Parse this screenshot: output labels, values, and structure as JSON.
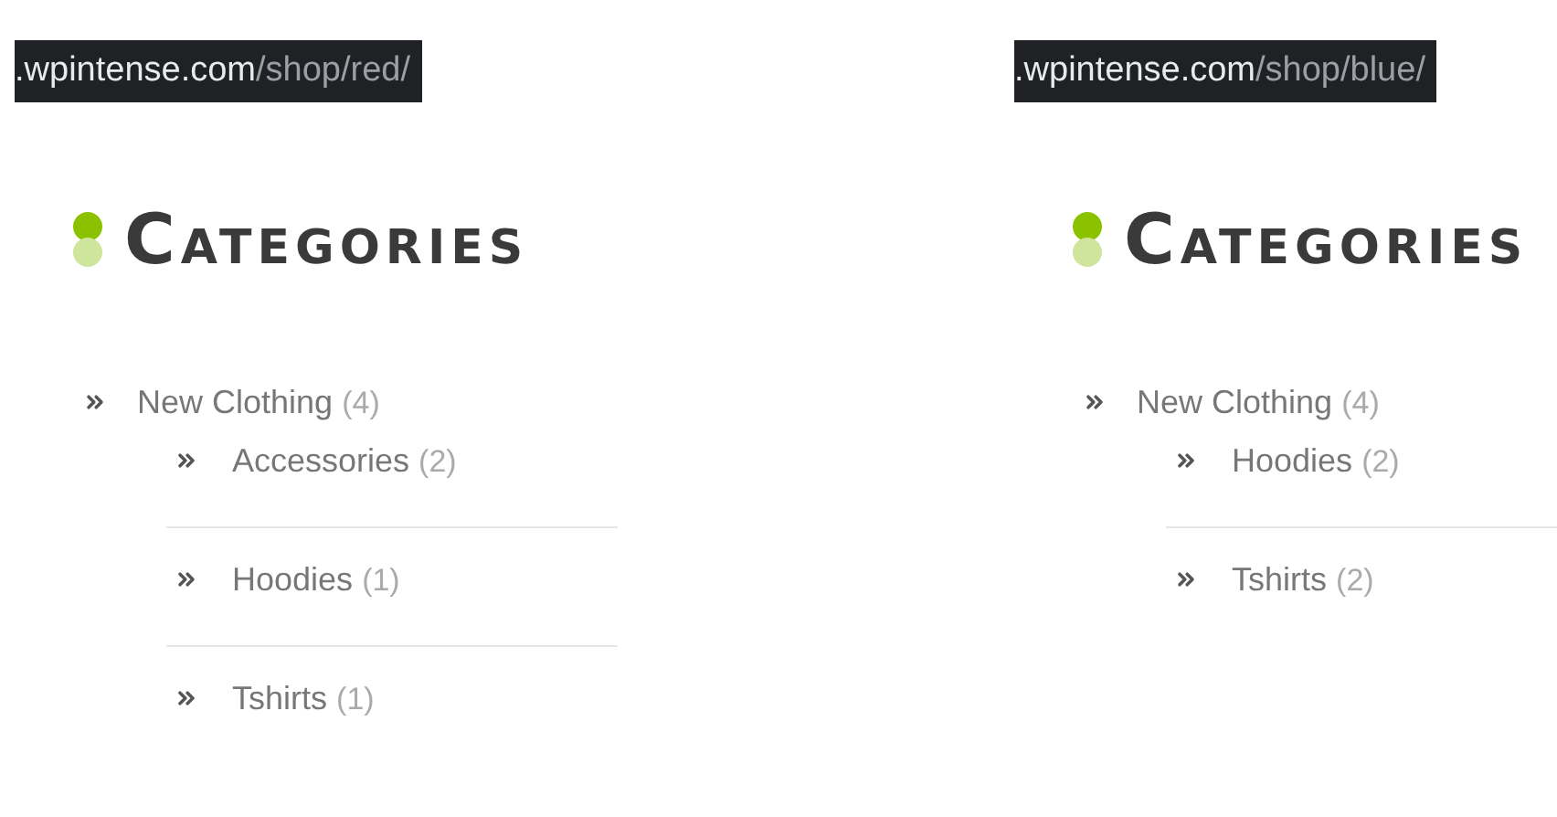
{
  "panels": [
    {
      "address": {
        "host": ".wpintense.com",
        "path": "/shop/red/"
      },
      "title": "CATEGORIES",
      "categories": [
        {
          "name": "New Clothing",
          "count": "(4)",
          "children": [
            {
              "name": "Accessories",
              "count": "(2)"
            },
            {
              "name": "Hoodies",
              "count": "(1)"
            },
            {
              "name": "Tshirts",
              "count": "(1)"
            }
          ]
        }
      ]
    },
    {
      "address": {
        "host": ".wpintense.com",
        "path": "/shop/blue/"
      },
      "title": "CATEGORIES",
      "categories": [
        {
          "name": "New Clothing",
          "count": "(4)",
          "children": [
            {
              "name": "Hoodies",
              "count": "(2)"
            },
            {
              "name": "Tshirts",
              "count": "(2)"
            }
          ]
        }
      ]
    }
  ]
}
